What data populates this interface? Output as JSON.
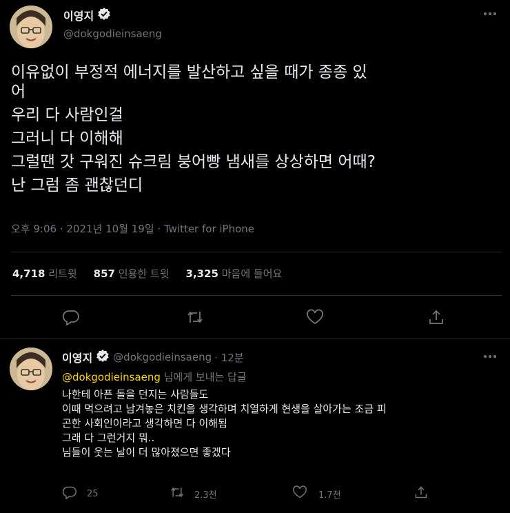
{
  "main_tweet": {
    "author_name": "이영지",
    "handle": "@dokgodieinsaeng",
    "text_lines": [
      "이유없이 부정적 에너지를 발산하고 싶을 때가 종종 있",
      "어",
      "우리 다 사람인걸",
      "그러니 다 이해해",
      "그럴땐 갓 구워진 슈크림 붕어빵 냄새를 상상하면 어때?",
      "난 그럼 좀 괜찮던디"
    ],
    "timestamp": "오후 9:06 · 2021년 10월 19일 · ",
    "source": "Twitter for iPhone",
    "stats": {
      "retweets_count": "4,718",
      "retweets_label": "리트윗",
      "quotes_count": "857",
      "quotes_label": "인용한 트윗",
      "likes_count": "3,325",
      "likes_label": "마음에 들어요"
    }
  },
  "reply_tweet": {
    "author_name": "이영지",
    "handle": "@dokgodieinsaeng",
    "time": "· 12분",
    "replying_to_mention": "@dokgodieinsaeng",
    "replying_to_suffix": " 님에게 보내는 답글",
    "text_lines": [
      "나한테 아픈 돌을 던지는 사람들도",
      "이때 먹으려고 남겨놓은 치킨을 생각하며 치열하게 현생을 살아가는 조금 피",
      "곤한 사회인이라고 생각하면 다 이해됨",
      "그래 다 그런거지 뭐..",
      "님들이 웃는 날이 더 많아졌으면 좋겠다"
    ],
    "reply_count": "25",
    "retweet_count": "2.3천",
    "like_count": "1.7천"
  },
  "colors": {
    "background": "#000000",
    "text": "#e7e9ea",
    "muted": "#71767b",
    "mention": "#ffd400",
    "verified": "#e7e9ea"
  },
  "icons": [
    "more-icon",
    "verified-icon",
    "reply-icon",
    "retweet-icon",
    "like-icon",
    "share-icon"
  ]
}
